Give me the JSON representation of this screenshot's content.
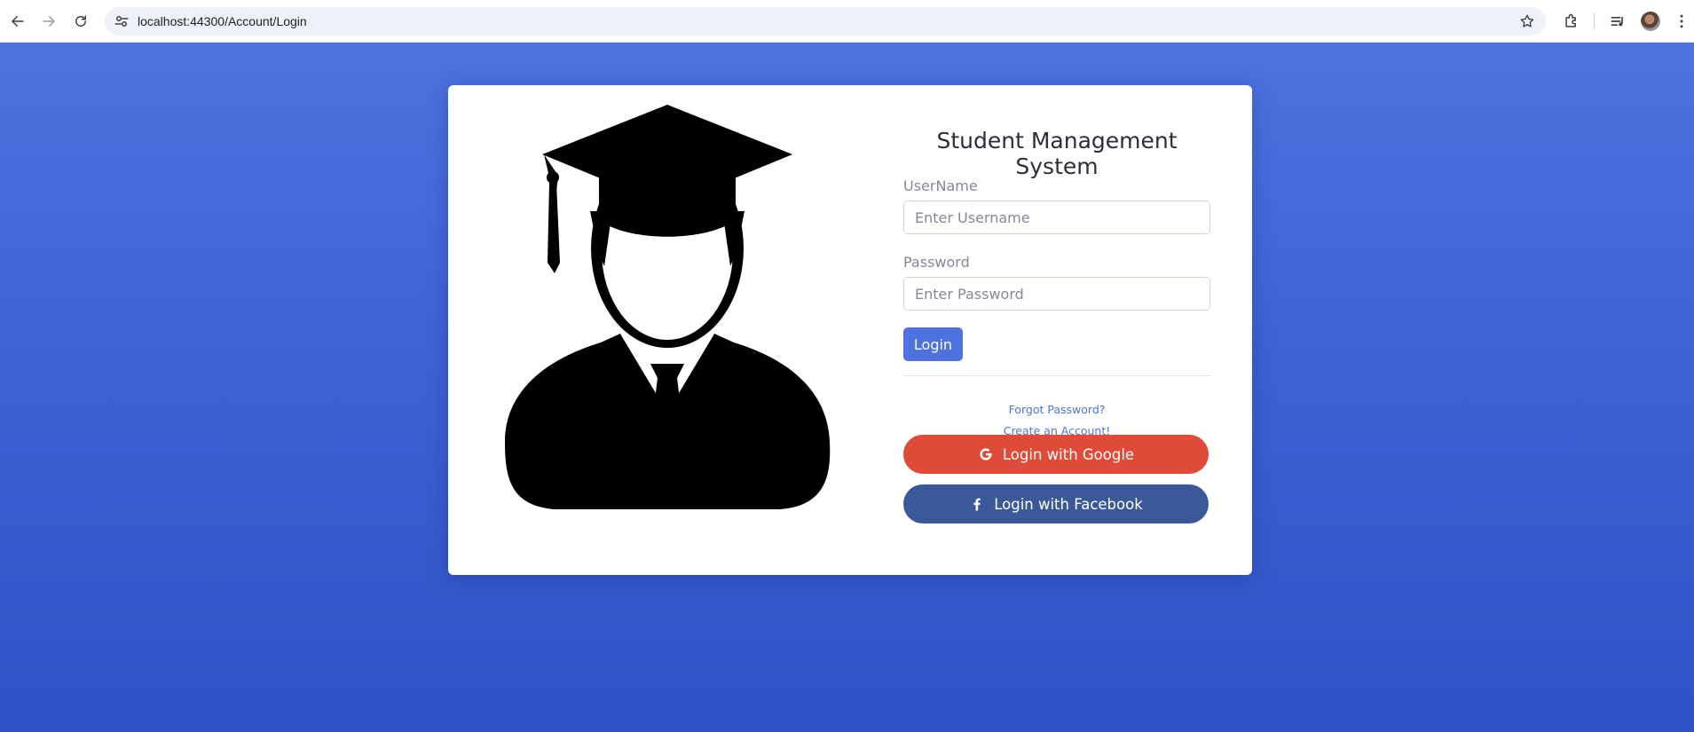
{
  "browser": {
    "url": "localhost:44300/Account/Login"
  },
  "login_card": {
    "title": "Student Management System",
    "username": {
      "label": "UserName",
      "placeholder": "Enter Username",
      "value": ""
    },
    "password": {
      "label": "Password",
      "placeholder": "Enter Password",
      "value": ""
    },
    "login_button": "Login",
    "forgot_password_link": "Forgot Password?",
    "create_account_link": "Create an Account!",
    "google_button": "Login with Google",
    "facebook_button": "Login with Facebook"
  },
  "icons": {
    "back": "arrow-left-icon",
    "forward": "arrow-right-icon",
    "reload": "reload-icon",
    "site_info": "tune-icon",
    "bookmark": "star-icon",
    "extensions": "puzzle-icon",
    "media": "media-queue-icon",
    "menu": "kebab-menu-icon",
    "google": "google-g-icon",
    "facebook": "facebook-f-icon"
  },
  "colors": {
    "page_background": "#4e73df",
    "primary": "#4e73df",
    "google": "#e04a38",
    "facebook": "#3b5998"
  }
}
